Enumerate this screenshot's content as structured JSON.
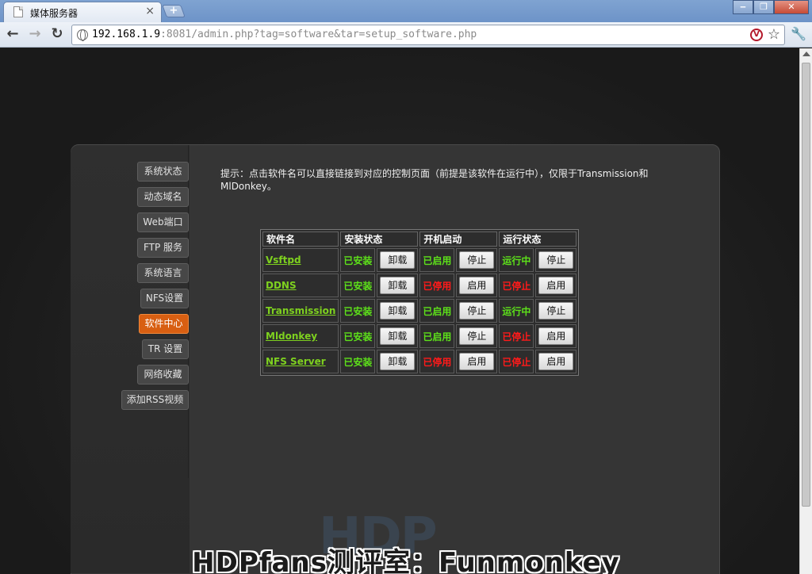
{
  "browser": {
    "tab_title": "媒体服务器",
    "tab_close": "×",
    "new_tab": "+",
    "url_host": "192.168.1.9",
    "url_rest": ":8081/admin.php?tag=software&tar=setup_software.php",
    "window_buttons": [
      "‒",
      "❐",
      "✕"
    ]
  },
  "sidebar": {
    "items": [
      {
        "label": "系统状态"
      },
      {
        "label": "动态域名"
      },
      {
        "label": "Web端口"
      },
      {
        "label": "FTP 服务"
      },
      {
        "label": "系统语言"
      },
      {
        "label": "NFS设置"
      },
      {
        "label": "软件中心",
        "active": true
      },
      {
        "label": "TR 设置"
      },
      {
        "label": "网络收藏"
      },
      {
        "label": "添加RSS视频"
      }
    ]
  },
  "main": {
    "hint": "提示：点击软件名可以直接链接到对应的控制页面（前提是该软件在运行中），仅限于Transmission和MlDonkey。",
    "table": {
      "headers": [
        "软件名",
        "安装状态",
        "开机启动",
        "运行状态"
      ],
      "rows": [
        {
          "name": "Vsftpd",
          "install": "已安装",
          "install_btn": "卸载",
          "boot": "已启用",
          "boot_color": "green",
          "boot_btn": "停止",
          "run": "运行中",
          "run_color": "green",
          "run_btn": "停止"
        },
        {
          "name": "DDNS",
          "install": "已安装",
          "install_btn": "卸载",
          "boot": "已停用",
          "boot_color": "red",
          "boot_btn": "启用",
          "run": "已停止",
          "run_color": "red",
          "run_btn": "启用"
        },
        {
          "name": "Transmission",
          "install": "已安装",
          "install_btn": "卸载",
          "boot": "已启用",
          "boot_color": "green",
          "boot_btn": "停止",
          "run": "运行中",
          "run_color": "green",
          "run_btn": "停止"
        },
        {
          "name": "Mldonkey",
          "install": "已安装",
          "install_btn": "卸载",
          "boot": "已启用",
          "boot_color": "green",
          "boot_btn": "停止",
          "run": "已停止",
          "run_color": "red",
          "run_btn": "启用"
        },
        {
          "name": "NFS Server",
          "install": "已安装",
          "install_btn": "卸载",
          "boot": "已停用",
          "boot_color": "red",
          "boot_btn": "启用",
          "run": "已停止",
          "run_color": "red",
          "run_btn": "启用"
        }
      ]
    }
  },
  "watermark": "HDP",
  "caption": "HDPfans测评室：Funmonkey",
  "colors": {
    "accent": "#d85f12",
    "status_green": "#5de01a",
    "status_red": "#ff1a1a",
    "link_green": "#7ed11f"
  }
}
